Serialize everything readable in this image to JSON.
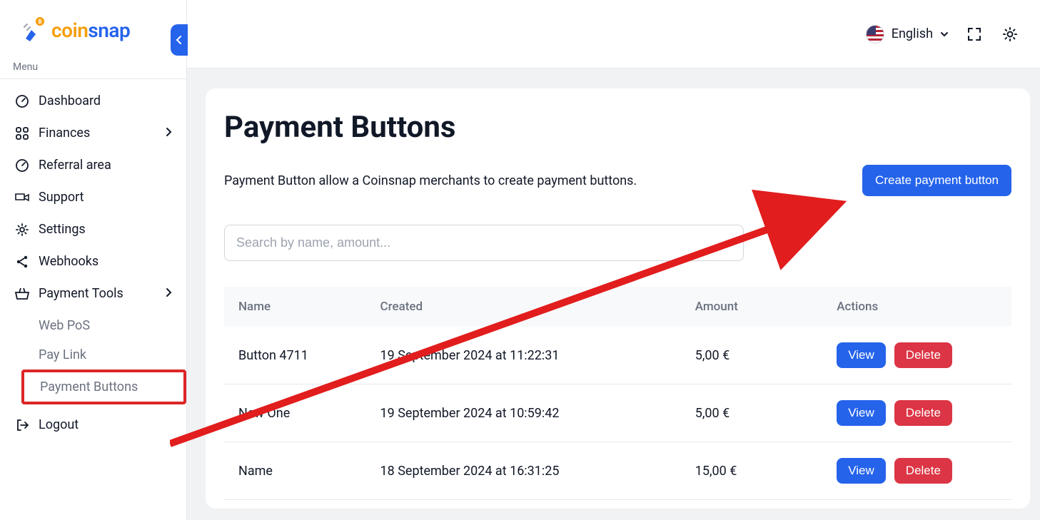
{
  "brand": {
    "part1": "coin",
    "part2": "snap"
  },
  "sidebar": {
    "menu_label": "Menu",
    "items": [
      {
        "label": "Dashboard",
        "icon": "gauge-icon",
        "expandable": false
      },
      {
        "label": "Finances",
        "icon": "grid-icon",
        "expandable": true
      },
      {
        "label": "Referral area",
        "icon": "gauge-icon",
        "expandable": false
      },
      {
        "label": "Support",
        "icon": "support-icon",
        "expandable": false
      },
      {
        "label": "Settings",
        "icon": "gear-icon",
        "expandable": false
      },
      {
        "label": "Webhooks",
        "icon": "share-icon",
        "expandable": false
      },
      {
        "label": "Payment Tools",
        "icon": "basket-icon",
        "expandable": true
      }
    ],
    "payment_tools_sub": [
      {
        "label": "Web PoS"
      },
      {
        "label": "Pay Link"
      },
      {
        "label": "Payment Buttons",
        "highlight": true
      }
    ],
    "logout_label": "Logout"
  },
  "topbar": {
    "language_label": "English"
  },
  "main": {
    "title": "Payment Buttons",
    "description": "Payment Button allow a Coinsnap merchants to create payment buttons.",
    "create_button_label": "Create payment button",
    "search_placeholder": "Search by name, amount..."
  },
  "table": {
    "columns": {
      "name": "Name",
      "created": "Created",
      "amount": "Amount",
      "actions": "Actions"
    },
    "action_labels": {
      "view": "View",
      "delete": "Delete"
    },
    "rows": [
      {
        "name": "Button 4711",
        "created": "19 September 2024 at 11:22:31",
        "amount": "5,00 €"
      },
      {
        "name": "New One",
        "created": "19 September 2024 at 10:59:42",
        "amount": "5,00 €"
      },
      {
        "name": "Name",
        "created": "18 September 2024 at 16:31:25",
        "amount": "15,00 €"
      }
    ]
  },
  "colors": {
    "accent": "#2563eb",
    "danger": "#dc3545",
    "highlight_border": "#dc2626"
  }
}
